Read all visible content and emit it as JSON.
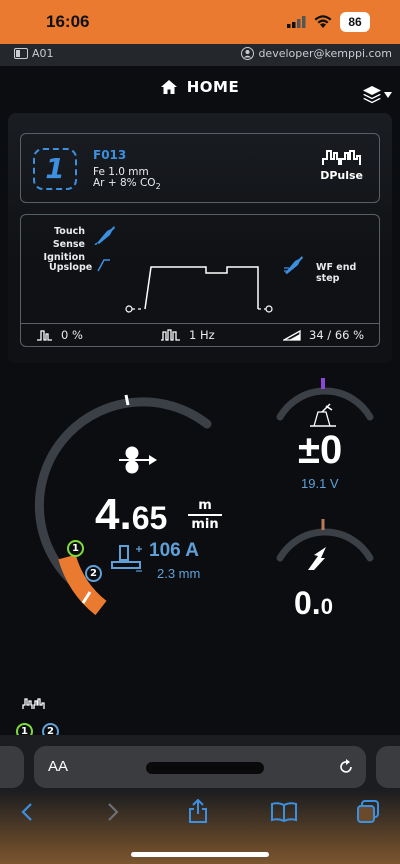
{
  "status_bar": {
    "time": "16:06",
    "battery": "86"
  },
  "info_bar": {
    "device": "A01",
    "user": "developer@kemppi.com"
  },
  "nav": {
    "title": "HOME"
  },
  "program": {
    "number": "1",
    "code": "F013",
    "wire": "Fe 1.0 mm",
    "gas_prefix": "Ar  + 8% CO",
    "gas_sub": "2",
    "process": "DPulse"
  },
  "sequence": {
    "touch_sense_line1": "Touch Sense",
    "touch_sense_line2": "Ignition",
    "upslope": "Upslope",
    "wf_end_step": "WF end step",
    "pulse_percent": "0 %",
    "pulse_freq": "1 Hz",
    "ratio": "34 / 66 %"
  },
  "wire_feed": {
    "value_int": "4.",
    "value_dec": "65",
    "unit_top": "m",
    "unit_bottom": "min",
    "current": "106 A",
    "thickness": "2.3 mm",
    "marker_1": "1",
    "marker_2": "2"
  },
  "voltage": {
    "fine_tune": "±0",
    "volts": "19.1 V"
  },
  "dynamics": {
    "value_int": "0.",
    "value_dec": "0"
  },
  "memory": {
    "ch1": "1",
    "ch2": "2"
  },
  "browser": {
    "text_size": "AA"
  },
  "colors": {
    "accent": "#e97a2f",
    "blue": "#3d8fe0",
    "value_blue": "#5fa0d8",
    "green": "#7ddc3c"
  }
}
